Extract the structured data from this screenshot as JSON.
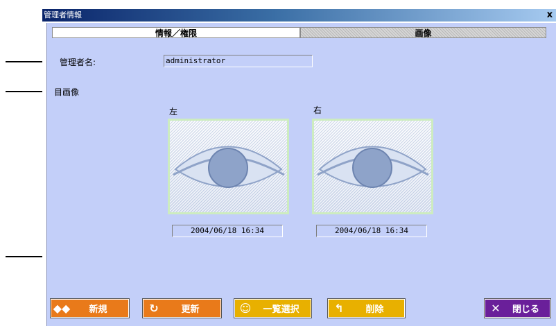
{
  "window": {
    "title": "管理者情報",
    "close_glyph": "x"
  },
  "tabs": [
    {
      "label": "情報／権限",
      "active": false
    },
    {
      "label": "画像",
      "active": true
    }
  ],
  "fields": {
    "admin_name_label": "管理者名:",
    "admin_name_value": "administrator",
    "eye_image_label": "目画像"
  },
  "eyes": [
    {
      "side_label": "左",
      "timestamp": "2004/06/18 16:34",
      "icon": "eye-icon"
    },
    {
      "side_label": "右",
      "timestamp": "2004/06/18 16:34",
      "icon": "eye-icon"
    }
  ],
  "buttons": {
    "new": {
      "label": "新規",
      "icon": "diamond-arrows-icon",
      "color": "#e97a1a"
    },
    "update": {
      "label": "更新",
      "icon": "refresh-icon",
      "color": "#e97a1a"
    },
    "list_select": {
      "label": "一覧選択",
      "icon": "list-select-icon",
      "color": "#e8b000"
    },
    "delete": {
      "label": "削除",
      "icon": "delete-icon",
      "color": "#e8b000"
    },
    "close": {
      "label": "閉じる",
      "icon": "close-x-icon",
      "color": "#6a1f9a"
    }
  },
  "colors": {
    "client_bg": "#c3cff9",
    "titlebar": "#0a246a",
    "eye_border": "#cdecc0"
  }
}
